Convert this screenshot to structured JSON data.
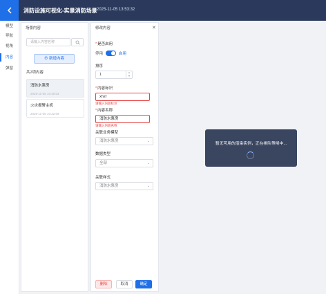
{
  "header": {
    "title": "消防设施可视化-实景消防场景",
    "datetime": "2025-11-05 13:53:32"
  },
  "nav": {
    "items": [
      {
        "label": "模型",
        "active": false
      },
      {
        "label": "导航",
        "active": false
      },
      {
        "label": "视角",
        "active": false
      },
      {
        "label": "内容",
        "active": true
      },
      {
        "label": "弹窗",
        "active": false
      }
    ]
  },
  "scene_panel": {
    "title": "场景内容",
    "search_placeholder": "请输入内容名称",
    "add_label": "⊕ 新增内容",
    "count_label": "共2项内容",
    "items": [
      {
        "name": "消防水泵房",
        "time": "2025-11-05 10:40:03",
        "selected": true
      },
      {
        "name": "火灾报警主机",
        "time": "2025-11-05 10:32:09",
        "selected": false
      }
    ]
  },
  "edit_panel": {
    "title": "修改内容",
    "enabled_label": "是否启用",
    "off_text": "停用",
    "on_text": "启用",
    "sort_label": "排序",
    "sort_value": "1",
    "id_label": "内容标识",
    "id_value": "xhsf",
    "id_error": "请输入内容标识",
    "name_label": "内容名称",
    "name_value": "消防水泵房",
    "name_error": "请输入内容名称",
    "model_label": "关联业务模型",
    "model_value": "消防水泵房",
    "type_label": "数据类型",
    "type_value": "全部",
    "style_label": "关联样式",
    "style_value": "消防水泵房",
    "delete_label": "删除",
    "cancel_label": "取消",
    "confirm_label": "确定"
  },
  "toast": {
    "message": "暂无可用的渲染实例，正在排队等候中..."
  },
  "colors": {
    "accent": "#1f6fe8",
    "header_bg": "#2b3a5c",
    "error": "#e54545",
    "toast_bg": "#3a4660"
  }
}
